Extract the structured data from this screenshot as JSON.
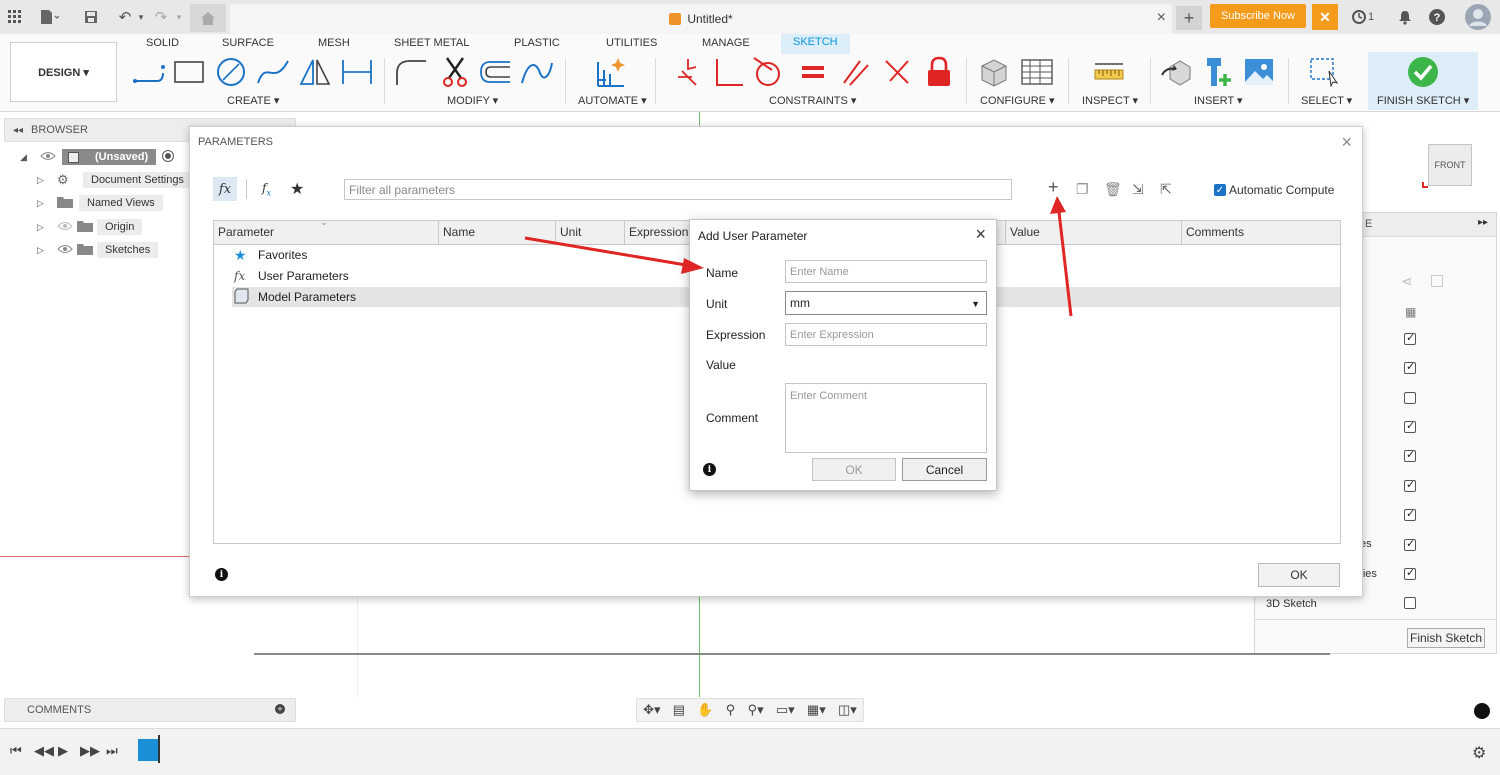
{
  "doc": {
    "title": "Untitled*"
  },
  "topbar": {
    "subscribe_label": "Subscribe Now",
    "badge_count": "1",
    "close_tab": "×",
    "new_tab": "+"
  },
  "ribbon": {
    "workspace": "DESIGN ▾",
    "tabs": [
      "SOLID",
      "SURFACE",
      "MESH",
      "SHEET METAL",
      "PLASTIC",
      "UTILITIES",
      "MANAGE",
      "SKETCH"
    ],
    "active_tab": "SKETCH",
    "groups": [
      "CREATE ▾",
      "MODIFY ▾",
      "AUTOMATE ▾",
      "CONSTRAINTS ▾",
      "CONFIGURE ▾",
      "INSPECT ▾",
      "INSERT ▾",
      "SELECT ▾",
      "FINISH SKETCH ▾"
    ]
  },
  "browser": {
    "title": "BROWSER",
    "items": [
      {
        "label": "(Unsaved)"
      },
      {
        "label": "Document Settings"
      },
      {
        "label": "Named Views"
      },
      {
        "label": "Origin"
      },
      {
        "label": "Sketches"
      }
    ]
  },
  "comments": {
    "label": "COMMENTS"
  },
  "viewcube": {
    "face": "FRONT"
  },
  "palette": {
    "rows": [
      {
        "text": "",
        "checked": true
      },
      {
        "text": "",
        "checked": true
      },
      {
        "text": "",
        "checked": false
      },
      {
        "text": "",
        "checked": true
      },
      {
        "text": "",
        "checked": true
      },
      {
        "text": "",
        "checked": true
      },
      {
        "text": "",
        "checked": true
      },
      {
        "text": "es",
        "checked": true
      },
      {
        "text": "etries",
        "checked": true
      },
      {
        "text": "3D Sketch",
        "checked": false
      }
    ],
    "finish_label": "Finish Sketch",
    "header_fragment": "E"
  },
  "parameters": {
    "title": "PARAMETERS",
    "filter_placeholder": "Filter all parameters",
    "auto_compute_label": "Automatic Compute",
    "columns": [
      "Parameter",
      "Name",
      "Unit",
      "Expression",
      "Value",
      "Comments"
    ],
    "rows": [
      "Favorites",
      "User Parameters",
      "Model Parameters"
    ],
    "ok_label": "OK"
  },
  "add_user_parameter": {
    "title": "Add User Parameter",
    "name_label": "Name",
    "name_placeholder": "Enter Name",
    "unit_label": "Unit",
    "unit_value": "mm",
    "expression_label": "Expression",
    "expression_placeholder": "Enter Expression",
    "value_label": "Value",
    "comment_label": "Comment",
    "comment_placeholder": "Enter Comment",
    "ok_label": "OK",
    "cancel_label": "Cancel"
  },
  "colors": {
    "accent": "#0696d7",
    "subscribe": "#f49b1c",
    "finish": "#3cb64b",
    "arrow": "#e02525"
  }
}
